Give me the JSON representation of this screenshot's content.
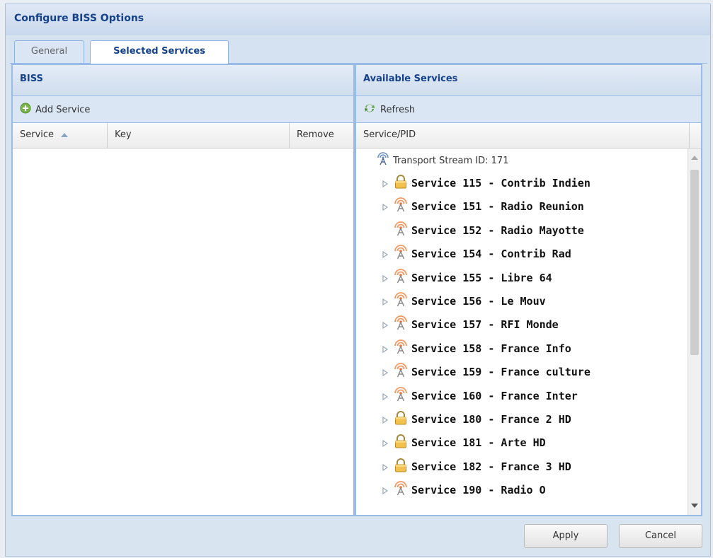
{
  "window": {
    "title": "Configure BISS Options"
  },
  "tabs": [
    {
      "label": "General"
    },
    {
      "label": "Selected Services"
    }
  ],
  "biss_panel": {
    "title": "BISS",
    "toolbar": {
      "add_label": "Add Service"
    },
    "columns": [
      "Service",
      "Key",
      "Remove"
    ]
  },
  "available_panel": {
    "title": "Available Services",
    "toolbar": {
      "refresh_label": "Refresh"
    },
    "column": "Service/PID",
    "transport_stream": "Transport Stream ID: 171",
    "services": [
      {
        "label": "Service 115 - Contrib Indien",
        "icon": "lock-icon",
        "expandable": true
      },
      {
        "label": "Service 151 - Radio Reunion",
        "icon": "antenna-icon",
        "expandable": true
      },
      {
        "label": "Service 152 - Radio Mayotte",
        "icon": "antenna-icon",
        "expandable": false
      },
      {
        "label": "Service 154 - Contrib Rad",
        "icon": "antenna-icon",
        "expandable": true
      },
      {
        "label": "Service 155 - Libre 64",
        "icon": "antenna-icon",
        "expandable": true
      },
      {
        "label": "Service 156 - Le Mouv",
        "icon": "antenna-icon",
        "expandable": true
      },
      {
        "label": "Service 157 - RFI Monde",
        "icon": "antenna-icon",
        "expandable": true
      },
      {
        "label": "Service 158 - France Info",
        "icon": "antenna-icon",
        "expandable": true
      },
      {
        "label": "Service 159 - France culture",
        "icon": "antenna-icon",
        "expandable": true
      },
      {
        "label": "Service 160 - France Inter",
        "icon": "antenna-icon",
        "expandable": true
      },
      {
        "label": "Service 180 - France 2 HD",
        "icon": "lock-icon",
        "expandable": true
      },
      {
        "label": "Service 181 - Arte HD",
        "icon": "lock-icon",
        "expandable": true
      },
      {
        "label": "Service 182 - France 3 HD",
        "icon": "lock-icon",
        "expandable": true
      },
      {
        "label": "Service 190 - Radio O",
        "icon": "antenna-icon",
        "expandable": true
      }
    ]
  },
  "footer": {
    "apply_label": "Apply",
    "cancel_label": "Cancel"
  }
}
